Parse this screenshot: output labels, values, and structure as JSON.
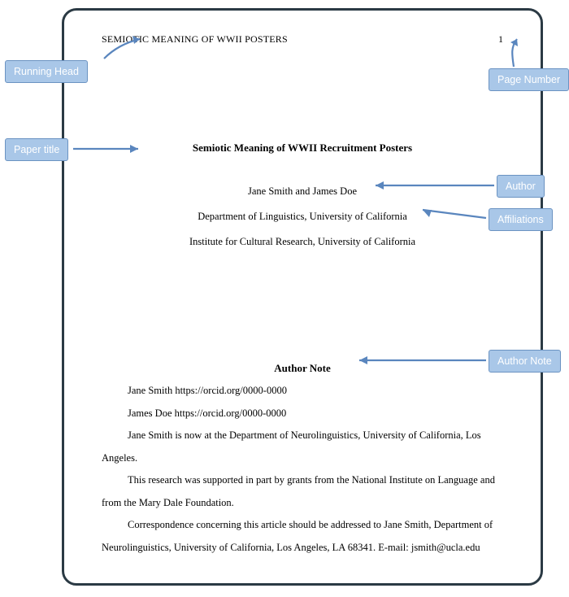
{
  "page": {
    "running_head": "SEMIOTIC MEANING OF WWII POSTERS",
    "page_number": "1",
    "title": "Semiotic Meaning of WWII Recruitment Posters",
    "authors_line": "Jane Smith and James Doe",
    "affiliation_1": "Department of Linguistics, University of California",
    "affiliation_2": "Institute for Cultural Research, University of California",
    "author_note_heading": "Author Note",
    "note_orcid_1": "Jane Smith https://orcid.org/0000-0000",
    "note_orcid_2": "James Doe https://orcid.org/0000-0000",
    "note_para_1": "Jane Smith is now at the Department of Neurolinguistics, University of California, Los Angeles.",
    "note_para_2": "This research was supported in part by grants from the National Institute on Language and from the Mary Dale Foundation.",
    "note_para_3": "Correspondence concerning this article should be addressed to Jane Smith, Department of Neurolinguistics, University of California, Los Angeles, LA 68341. E-mail: jsmith@ucla.edu"
  },
  "callouts": {
    "running_head": "Running Head",
    "page_number": "Page Number",
    "paper_title": "Paper title",
    "author": "Author",
    "affiliations": "Affiliations",
    "author_note": "Author Note"
  }
}
